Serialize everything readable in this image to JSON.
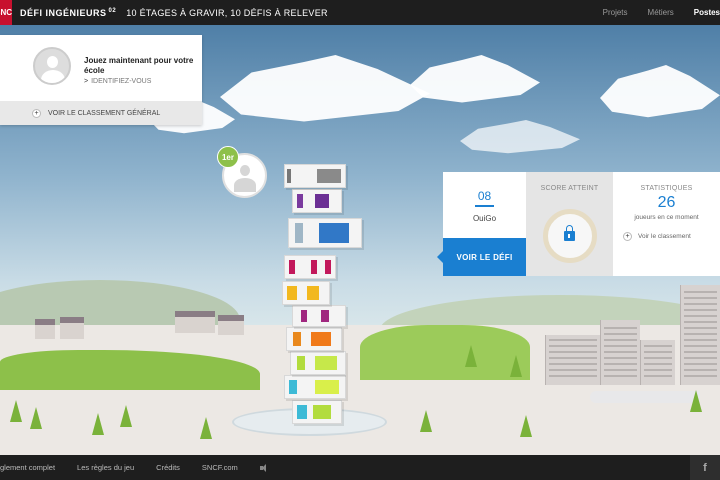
{
  "topbar": {
    "logo_text": "SNCF",
    "brand": "DÉFI INGÉNIEURS",
    "brand_sup": "02",
    "tagline": "10 ÉTAGES À GRAVIR, 10 DÉFIS À RELEVER",
    "nav": [
      "Projets",
      "Métiers",
      "Postes"
    ]
  },
  "school_card": {
    "title": "Jouez maintenant pour votre école",
    "identify": "IDENTIFIEZ-VOUS",
    "ranking": "VOIR LE CLASSEMENT GÉNÉRAL"
  },
  "rank": {
    "badge": "1er"
  },
  "level_panel": {
    "number": "08",
    "name": "OuiGo",
    "button": "VOIR LE DÉFI",
    "score_label": "SCORE ATTEINT",
    "stats_label": "STATISTIQUES",
    "players": "26",
    "players_sub": "joueurs en ce moment",
    "ranking_link": "Voir le classement"
  },
  "footer": {
    "links": [
      "glement complet",
      "Les règles du jeu",
      "Crédits",
      "SNCF.com"
    ],
    "facebook": "f"
  },
  "colors": {
    "accent": "#1a7fd1",
    "brand_red": "#c8102e",
    "badge_green": "#8dc04a"
  }
}
